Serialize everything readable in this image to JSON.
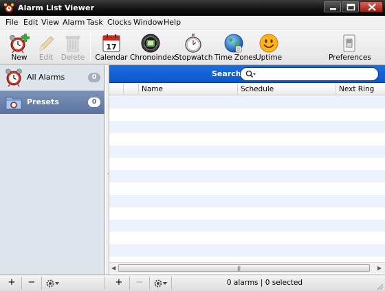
{
  "window": {
    "title": "Alarm List Viewer",
    "accent": "#0f5fd6"
  },
  "menu": [
    "File",
    "Edit",
    "View",
    "Alarm",
    "Task",
    "Clocks",
    "Window",
    "Help"
  ],
  "toolbar": {
    "new_label": "New",
    "edit_label": "Edit",
    "delete_label": "Delete",
    "calendar_label": "Calendar",
    "calendar_day": "17",
    "chronoindex_label": "Chronoindex",
    "stopwatch_label": "Stopwatch",
    "timezones_label": "Time Zones",
    "uptime_label": "Uptime",
    "preferences_label": "Preferences"
  },
  "sidebar": {
    "items": [
      {
        "label": "All Alarms",
        "count": "0",
        "icon": "alarm-clock-icon",
        "selected": false
      },
      {
        "label": "Presets",
        "count": "0",
        "icon": "presets-folder-icon",
        "selected": true
      }
    ]
  },
  "search": {
    "label": "Search",
    "value": "",
    "placeholder": ""
  },
  "table": {
    "columns": [
      "",
      "",
      "Name",
      "Schedule",
      "Next Ring"
    ],
    "rows": []
  },
  "status": {
    "text": "0 alarms | 0 selected"
  },
  "bottom_bar": {
    "add_label": "+",
    "remove_label": "−"
  }
}
